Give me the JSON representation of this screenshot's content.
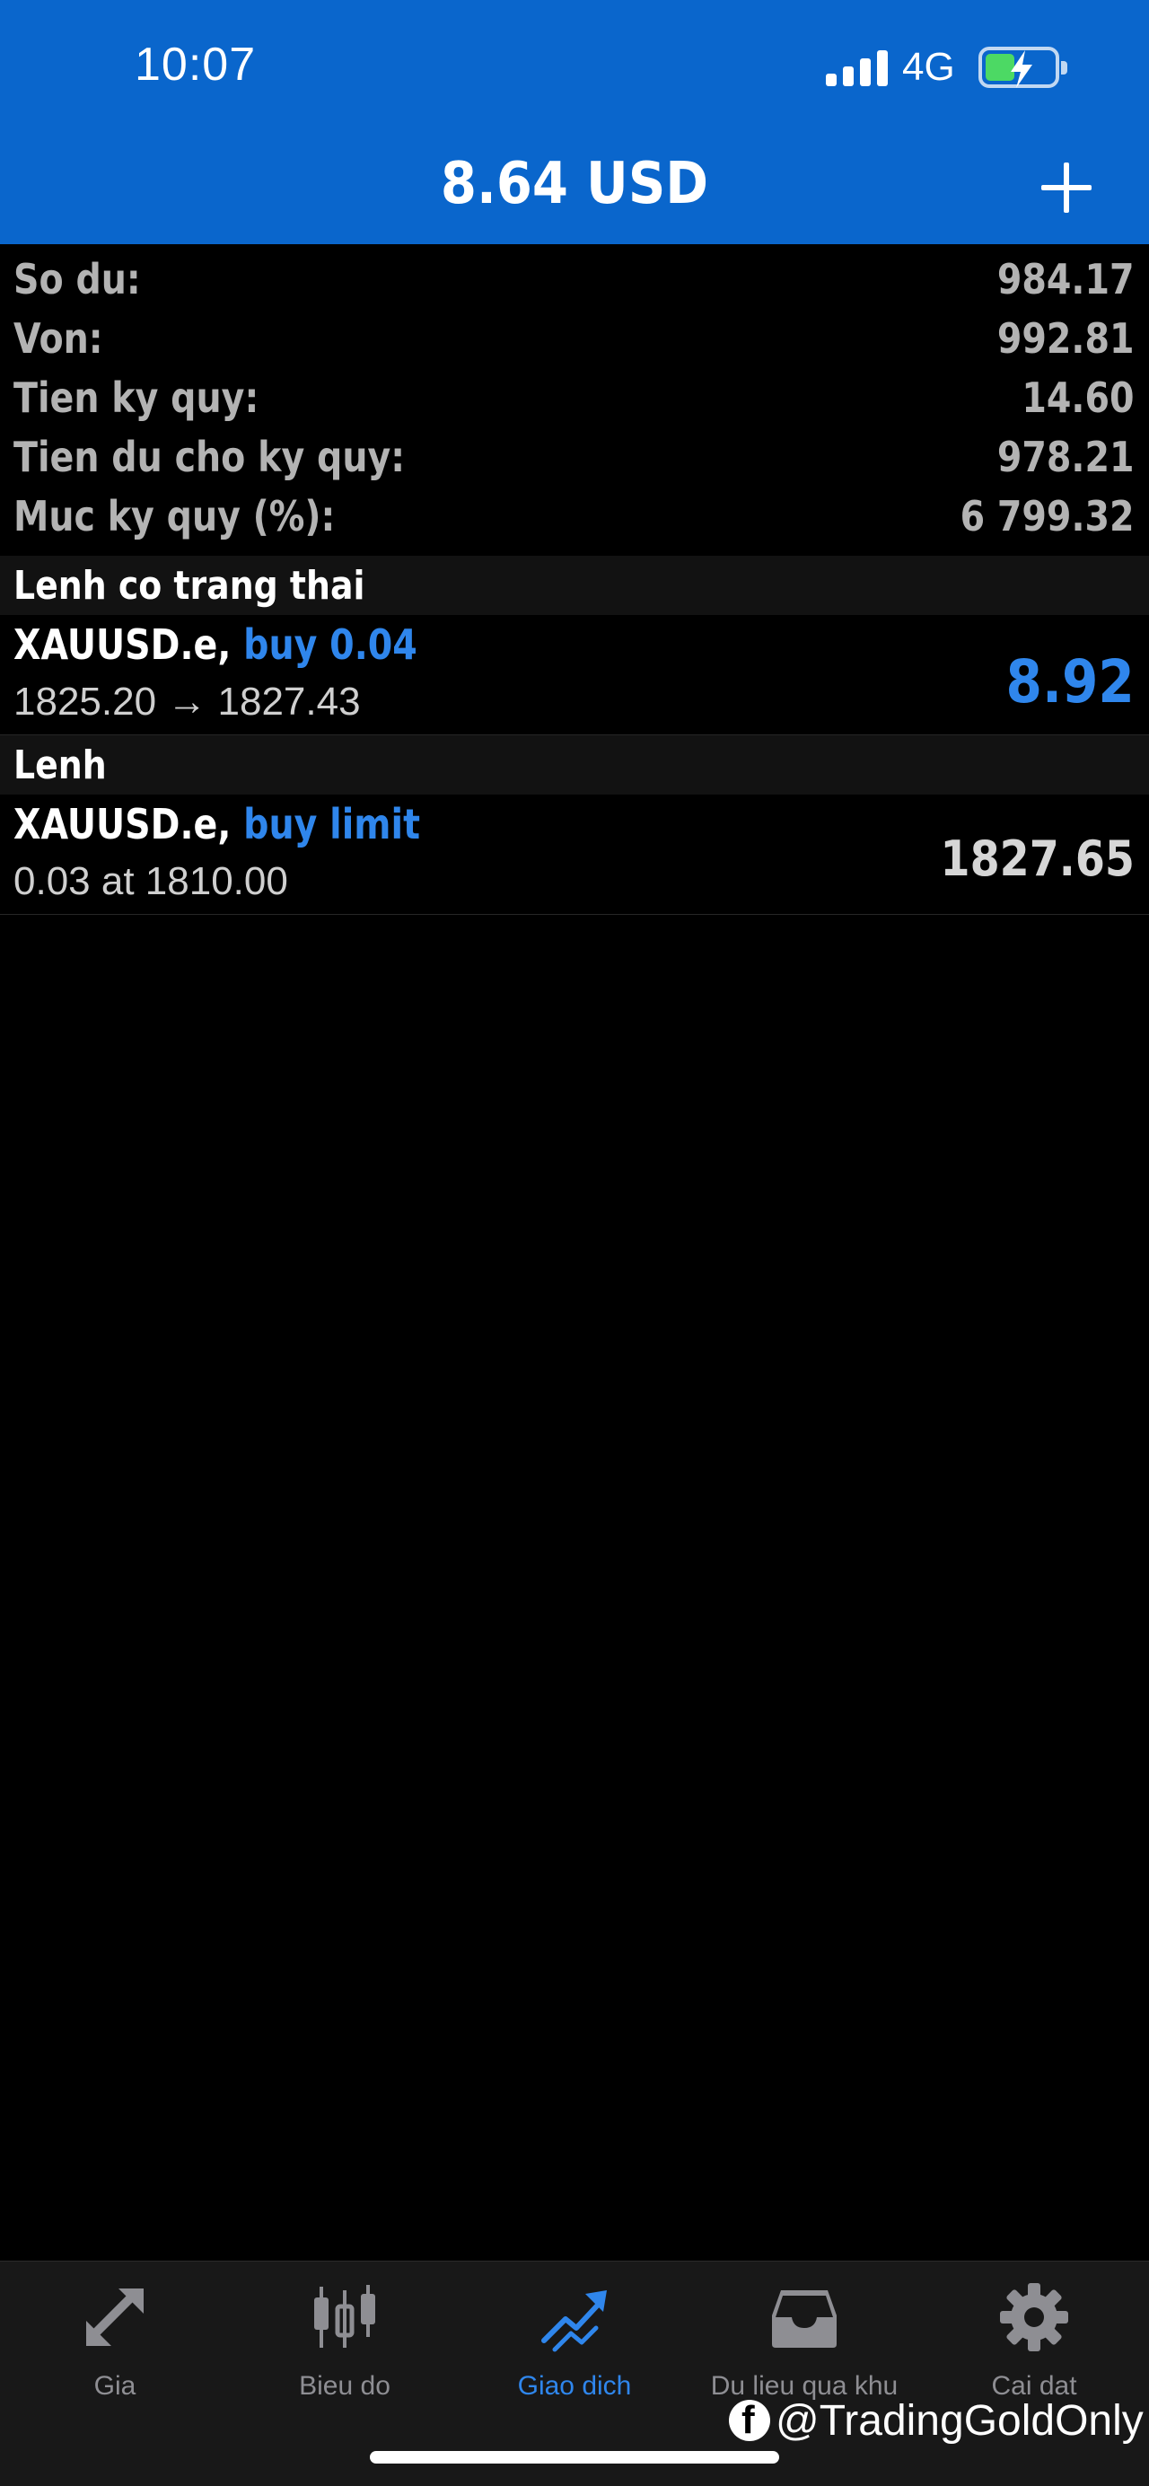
{
  "status_bar": {
    "time": "10:07",
    "network": "4G"
  },
  "header": {
    "title": "8.64 USD"
  },
  "summary": [
    {
      "label": "So du:",
      "value": "984.17"
    },
    {
      "label": "Von:",
      "value": "992.81"
    },
    {
      "label": "Tien ky quy:",
      "value": "14.60"
    },
    {
      "label": "Tien du cho ky quy:",
      "value": "978.21"
    },
    {
      "label": "Muc ky quy (%):",
      "value": "6 799.32"
    }
  ],
  "positions": {
    "section_title": "Lenh co trang thai",
    "items": [
      {
        "symbol": "XAUUSD.e,",
        "action": "buy 0.04",
        "detail": "1825.20 → 1827.43",
        "profit": "8.92"
      }
    ]
  },
  "orders": {
    "section_title": "Lenh",
    "items": [
      {
        "symbol": "XAUUSD.e,",
        "action": "buy limit",
        "detail": "0.03 at 1810.00",
        "price": "1827.65"
      }
    ]
  },
  "tabbar": {
    "tabs": [
      {
        "label": "Gia",
        "icon": "quotes-arrows-icon"
      },
      {
        "label": "Bieu do",
        "icon": "candlestick-chart-icon"
      },
      {
        "label": "Giao dich",
        "icon": "trade-trend-icon",
        "active": true
      },
      {
        "label": "Du lieu qua khu",
        "icon": "history-tray-icon"
      },
      {
        "label": "Cai dat",
        "icon": "gear-icon"
      }
    ]
  },
  "watermark": "@TradingGoldOnly",
  "colors": {
    "header_bg": "#0a66cc",
    "accent": "#2f86ec",
    "background": "#000000",
    "tabbar_bg": "#181818"
  }
}
